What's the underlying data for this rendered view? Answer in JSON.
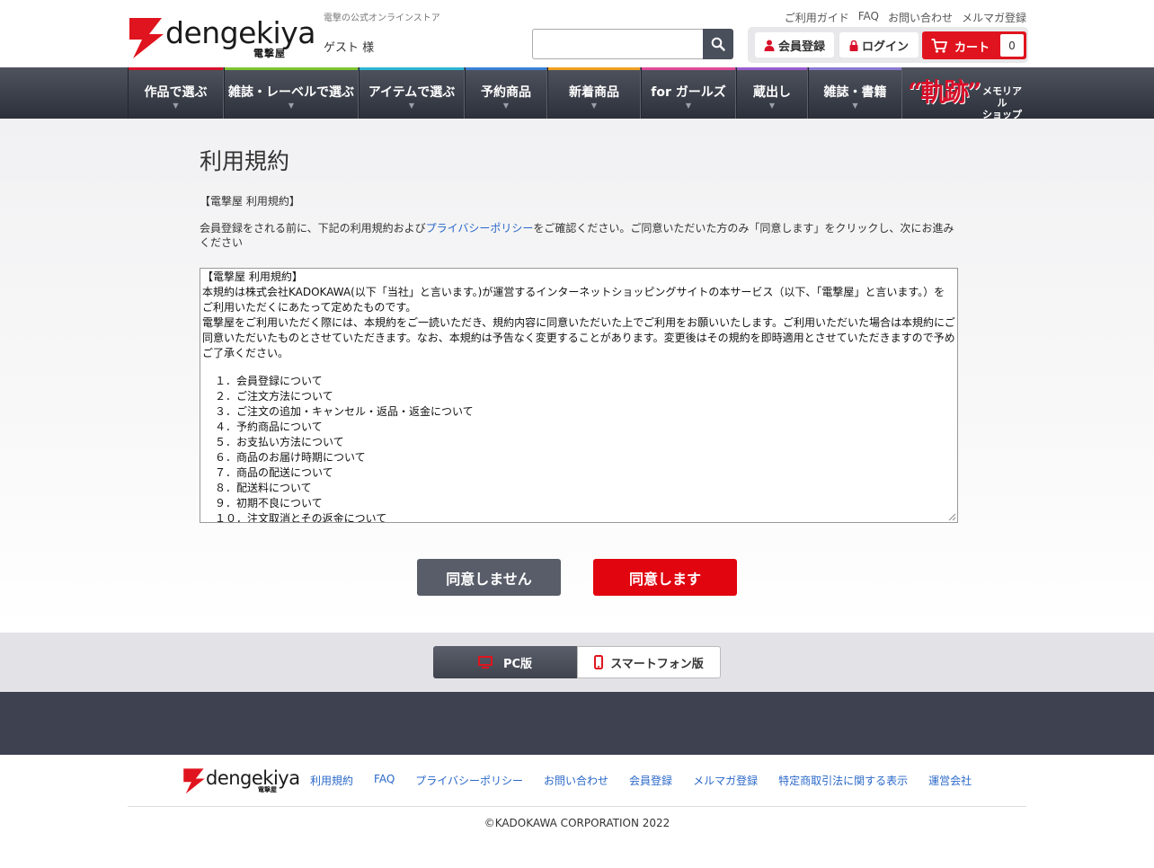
{
  "header": {
    "logo_text": "dengekiya",
    "logo_sub": "電撃屋",
    "tagline": "電撃の公式オンラインストア",
    "guest": "ゲスト 様",
    "top_links": [
      "ご利用ガイド",
      "FAQ",
      "お問い合わせ",
      "メルマガ登録"
    ],
    "search_placeholder": "",
    "register_label": "会員登録",
    "login_label": "ログイン",
    "cart_label": "カート",
    "cart_count": "0"
  },
  "nav": {
    "items": [
      {
        "label": "作品で選ぶ",
        "color": "#d8102a"
      },
      {
        "label": "雑誌・レーベルで選ぶ",
        "color": "#7cc530"
      },
      {
        "label": "アイテムで選ぶ",
        "color": "#2cb6d2"
      },
      {
        "label": "予約商品",
        "color": "#3a7fd5"
      },
      {
        "label": "新着商品",
        "color": "#f0a020"
      },
      {
        "label": "for ガールズ",
        "color": "#e04a98"
      },
      {
        "label": "蔵出し",
        "color": "#9a5cd0"
      },
      {
        "label": "雑誌・書籍",
        "color": "#8a7ad0"
      }
    ],
    "special_main": "“軌跡”",
    "special_sub1": "メモリアル",
    "special_sub2": "ショップ"
  },
  "main": {
    "title": "利用規約",
    "subhead": "【電撃屋 利用規約】",
    "intro_before": "会員登録をされる前に、下記の利用規約および",
    "intro_link": "プライバシーポリシー",
    "intro_after": "をご確認ください。ご同意いただいた方のみ「同意します」をクリックし、次にお進みください",
    "terms": {
      "heading": "【電撃屋 利用規約】",
      "para1": "本規約は株式会社KADOKAWA(以下「当社」と言います。)が運営するインターネットショッピングサイトの本サービス（以下、「電撃屋」と言います。）をご利用いただくにあたって定めたものです。",
      "para2": "電撃屋をご利用いただく際には、本規約をご一読いただき、規約内容に同意いただいた上でご利用をお願いいたします。ご利用いただいた場合は本規約にご同意いただいたものとさせていただきます。なお、本規約は予告なく変更することがあります。変更後はその規約を即時適用とさせていただきますので予めご了承ください。",
      "toc": [
        "１．会員登録について",
        "２．ご注文方法について",
        "３．ご注文の追加・キャンセル・返品・返金について",
        "４．予約商品について",
        "５．お支払い方法について",
        "６．商品のお届け時期について",
        "７．商品の配送について",
        "８．配送料について",
        "９．初期不良について",
        "１０．注文取消とその返金について"
      ]
    },
    "decline_label": "同意しません",
    "agree_label": "同意します"
  },
  "version": {
    "pc_label": "PC版",
    "sp_label": "スマートフォン版"
  },
  "footer": {
    "logo_text": "dengekiya",
    "logo_sub": "電撃屋",
    "links": [
      "利用規約",
      "FAQ",
      "プライバシーポリシー",
      "お問い合わせ",
      "会員登録",
      "メルマガ登録",
      "特定商取引法に関する表示",
      "運営会社"
    ],
    "copyright": "©KADOKAWA CORPORATION 2022"
  },
  "colors": {
    "brand_red": "#e0141e",
    "nav_dark": "#3a3e48",
    "link_blue": "#2a68c8"
  }
}
